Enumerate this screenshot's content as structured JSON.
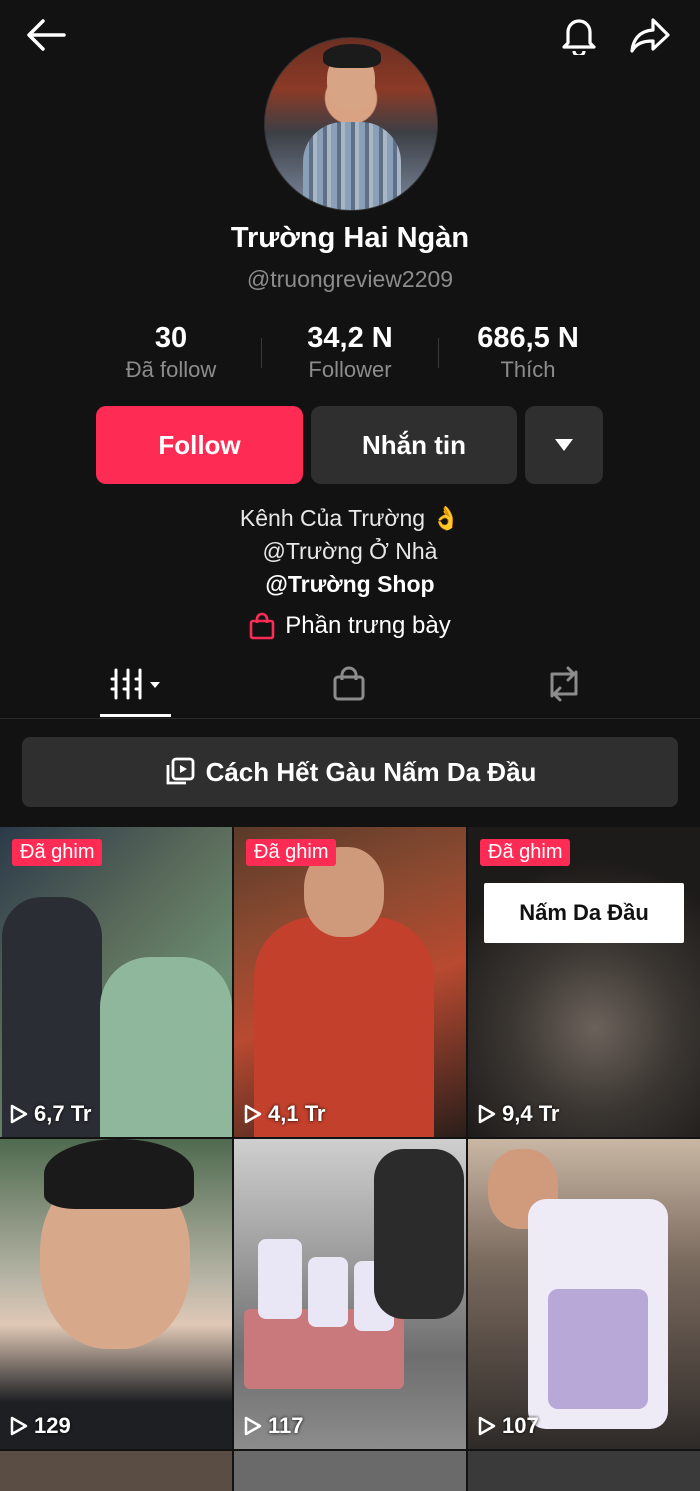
{
  "profile": {
    "name": "Trường Hai Ngàn",
    "handle": "@truongreview2209"
  },
  "stats": [
    {
      "value": "30",
      "label": "Đã follow"
    },
    {
      "value": "34,2 N",
      "label": "Follower"
    },
    {
      "value": "686,5 N",
      "label": "Thích"
    }
  ],
  "actions": {
    "follow": "Follow",
    "message": "Nhắn tin"
  },
  "bio": {
    "line1": "Kênh Của Trường 👌",
    "line2": "@Trường Ở Nhà",
    "line3": "@Trường Shop"
  },
  "showcase": "Phần trưng bày",
  "playlist": "Cách Hết Gàu Nấm Da Đầu",
  "videos": [
    {
      "pinned": "Đã ghim",
      "views": "6,7 Tr"
    },
    {
      "pinned": "Đã ghim",
      "views": "4,1 Tr"
    },
    {
      "pinned": "Đã ghim",
      "views": "9,4 Tr",
      "overlay": "Nấm Da Đầu"
    },
    {
      "views": "129"
    },
    {
      "views": "117"
    },
    {
      "views": "107"
    }
  ],
  "colors": {
    "background": "#121212",
    "accent": "#fe2c55",
    "muted": "#8c8c8c",
    "button_dark": "#2f2f2f"
  },
  "icons": {
    "back": "arrow-left-icon",
    "bell": "bell-icon",
    "share": "share-arrow-icon",
    "dropdown": "caret-down-icon",
    "bag": "shopping-bag-icon",
    "videos_tab": "grid-bars-icon",
    "shop_tab": "bag-outline-icon",
    "repost_tab": "repost-icon",
    "playlist": "playlist-icon",
    "play": "play-icon"
  }
}
